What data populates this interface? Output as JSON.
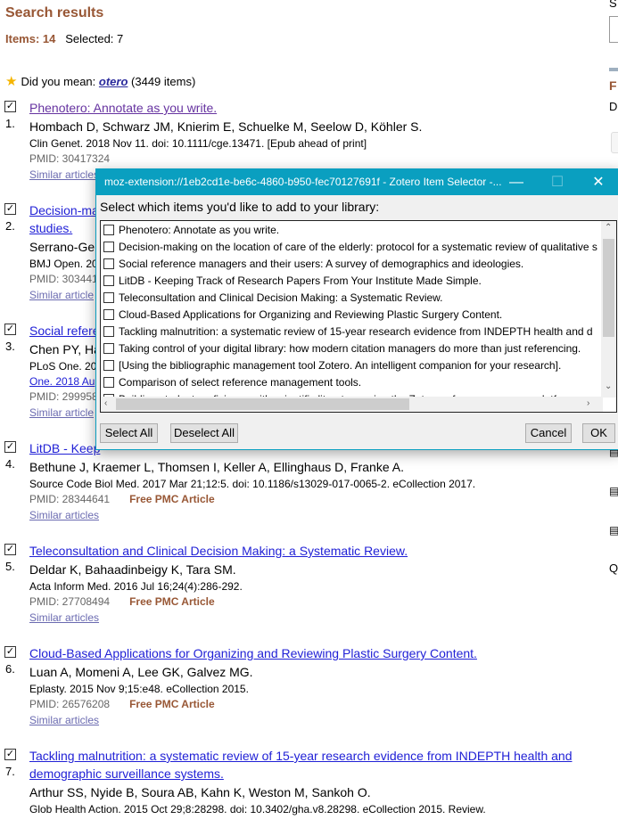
{
  "header": {
    "title": "Search results",
    "items_label": "Items: 14",
    "selected_label": "Selected: 7"
  },
  "did_you_mean": {
    "prefix": "Did you mean:",
    "term": "otero",
    "suffix": "(3449 items)",
    "icon": "star-icon"
  },
  "articles": [
    {
      "num": "1.",
      "title": "Phenotero: Annotate as you write.",
      "visited": true,
      "authors": "Hombach D, Schwarz JM, Knierim E, Schuelke M, Seelow D, Köhler S.",
      "journal": "Clin Genet. 2018 Nov 11. doi: 10.1111/cge.13471. [Epub ahead of print]",
      "pmid": "PMID: 30417324",
      "free": "",
      "similar": "Similar articles"
    },
    {
      "num": "2.",
      "title": "Decision-ma",
      "title2": "studies.",
      "authors": "Serrano-Ge",
      "journal": "BMJ Open. 20",
      "pmid": "PMID: 303441",
      "free": "",
      "similar": "Similar article"
    },
    {
      "num": "3.",
      "title": "Social refere",
      "authors": "Chen PY, Ha",
      "journal": "PLoS One. 20",
      "journal_link": "One. 2018 Au",
      "pmid": "PMID: 299958",
      "free": "",
      "similar": "Similar article"
    },
    {
      "num": "4.",
      "title": "LitDB - Keep",
      "authors": "Bethune J, Kraemer L, Thomsen I, Keller A, Ellinghaus D, Franke A.",
      "journal": "Source Code Biol Med. 2017 Mar 21;12:5. doi: 10.1186/s13029-017-0065-2. eCollection 2017.",
      "pmid": "PMID: 28344641",
      "free": "Free PMC Article",
      "similar": "Similar articles"
    },
    {
      "num": "5.",
      "title": "Teleconsultation and Clinical Decision Making: a Systematic Review.",
      "authors": "Deldar K, Bahaadinbeigy K, Tara SM.",
      "journal": "Acta Inform Med. 2016 Jul 16;24(4):286-292.",
      "pmid": "PMID: 27708494",
      "free": "Free PMC Article",
      "similar": "Similar articles"
    },
    {
      "num": "6.",
      "title": "Cloud-Based Applications for Organizing and Reviewing Plastic Surgery Content.",
      "authors": "Luan A, Momeni A, Lee GK, Galvez MG.",
      "journal": "Eplasty. 2015 Nov 9;15:e48. eCollection 2015.",
      "pmid": "PMID: 26576208",
      "free": "Free PMC Article",
      "similar": "Similar articles"
    },
    {
      "num": "7.",
      "title": "Tackling malnutrition: a systematic review of 15-year research evidence from INDEPTH health and demographic surveillance systems.",
      "authors": "Arthur SS, Nyide B, Soura AB, Kahn K, Weston M, Sankoh O.",
      "journal": "Glob Health Action. 2015 Oct 29;8:28298. doi: 10.3402/gha.v8.28298. eCollection 2015. Review.",
      "pmid": "",
      "free": "",
      "similar": ""
    }
  ],
  "sidebar": {
    "s": "S",
    "f": "F",
    "d": "D"
  },
  "dialog": {
    "title": "moz-extension://1eb2cd1e-be6c-4860-b950-fec70127691f - Zotero Item Selector -...",
    "prompt": "Select which items you'd like to add to your library:",
    "items": [
      "Phenotero: Annotate as you write.",
      "Decision-making on the location of care of the elderly: protocol for a systematic review of qualitative s",
      "Social reference managers and their users: A survey of demographics and ideologies.",
      "LitDB - Keeping Track of Research Papers From Your Institute Made Simple.",
      "Teleconsultation and Clinical Decision Making: a Systematic Review.",
      "Cloud-Based Applications for Organizing and Reviewing Plastic Surgery Content.",
      "Tackling malnutrition: a systematic review of 15-year research evidence from INDEPTH health and d",
      "Taking control of your digital library: how modern citation managers do more than just referencing.",
      "[Using the bibliographic management tool Zotero. An intelligent companion for your research].",
      "Comparison of select reference management tools.",
      "Building student proficiency with scientific literature using the Zotero reference manager platform."
    ],
    "select_all": "Select All",
    "deselect_all": "Deselect All",
    "cancel": "Cancel",
    "ok": "OK",
    "accent": "#0a9fc0"
  }
}
